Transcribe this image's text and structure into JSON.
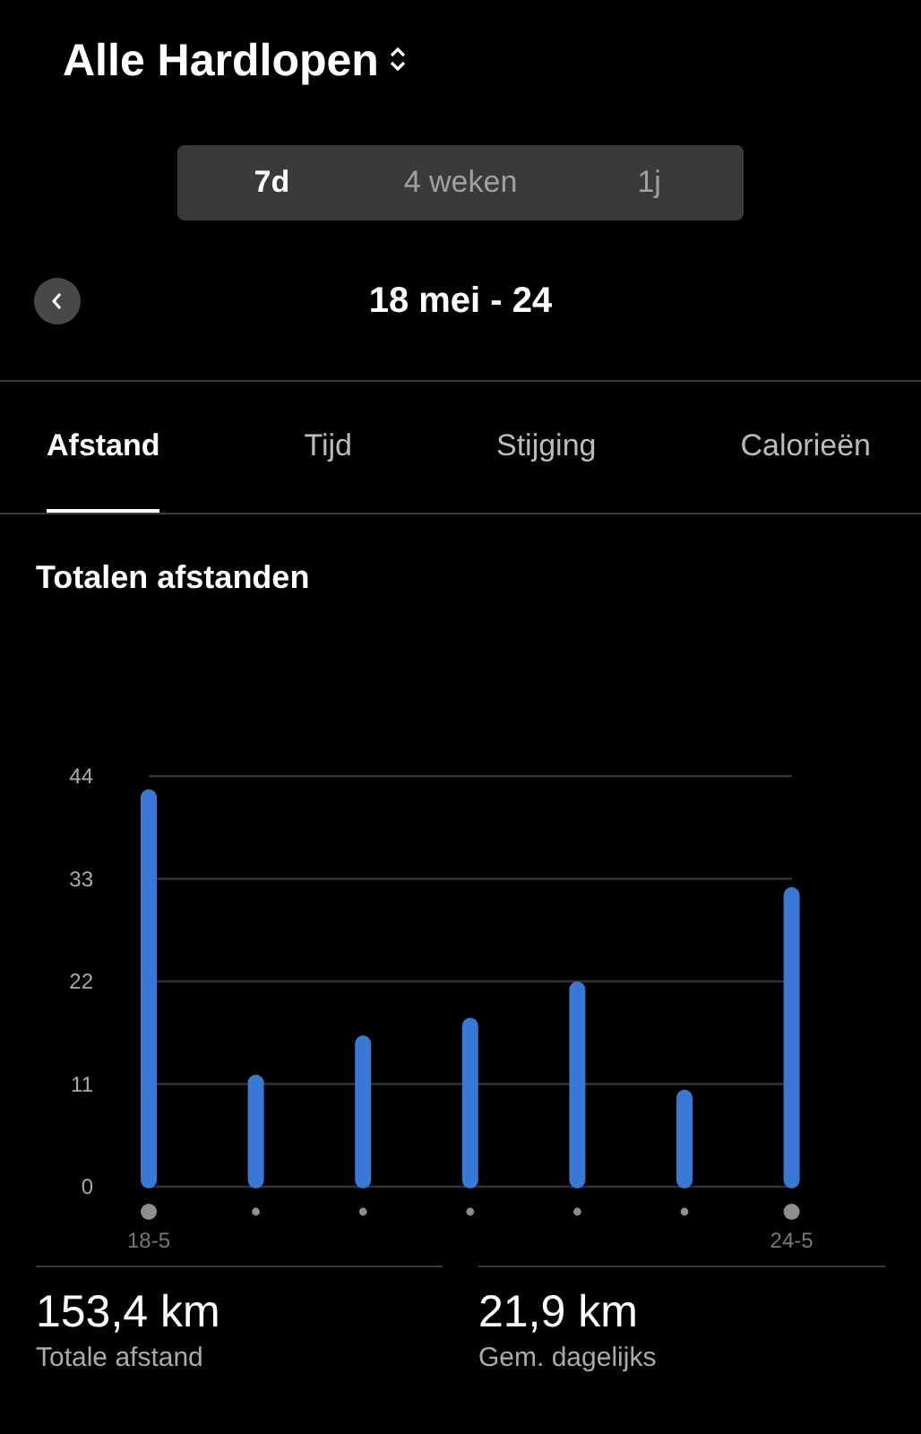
{
  "header": {
    "title": "Alle Hardlopen"
  },
  "periods": [
    {
      "label": "7d",
      "selected": true
    },
    {
      "label": "4 weken",
      "selected": false
    },
    {
      "label": "1j",
      "selected": false
    }
  ],
  "date_range": "18 mei - 24",
  "tabs": [
    {
      "label": "Afstand",
      "selected": true
    },
    {
      "label": "Tijd",
      "selected": false
    },
    {
      "label": "Stijging",
      "selected": false
    },
    {
      "label": "Calorieën",
      "selected": false
    }
  ],
  "section_title": "Totalen afstanden",
  "chart_data": {
    "type": "bar",
    "categories": [
      "18-5",
      null,
      null,
      null,
      null,
      null,
      "24-5"
    ],
    "yticks": [
      0,
      11,
      22,
      33,
      44
    ],
    "ylim": [
      0,
      44
    ],
    "grid": true,
    "series": [
      {
        "color": "#3a78d6",
        "values": [
          42.6,
          12,
          16.2,
          18.1,
          22,
          10.4,
          32.1
        ]
      }
    ]
  },
  "stats": [
    {
      "value": "153,4 km",
      "label": "Totale afstand"
    },
    {
      "value": "21,9 km",
      "label": "Gem. dagelijks"
    }
  ]
}
